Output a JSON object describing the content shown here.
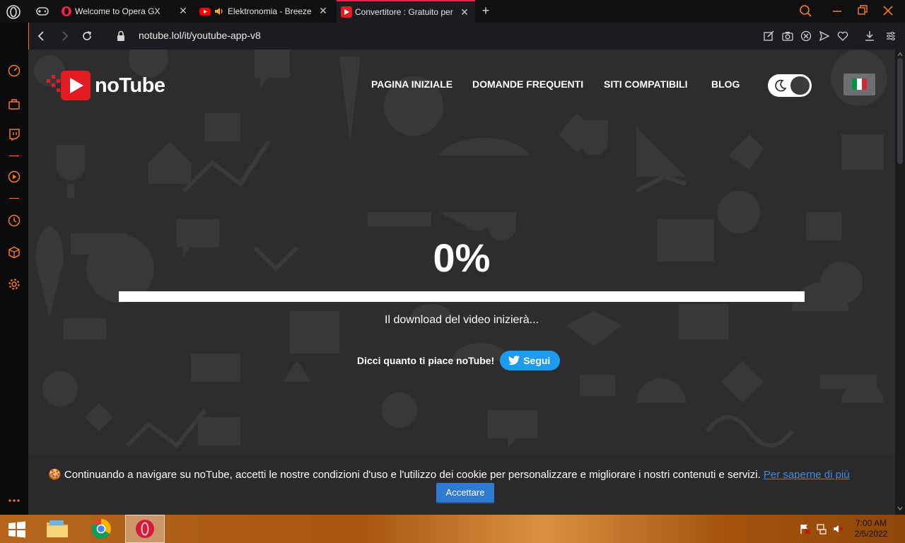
{
  "tabs": [
    {
      "title": "Welcome to Opera GX",
      "favicon": "opera-icon"
    },
    {
      "title": "Elektronomia - Breeze",
      "favicon": "youtube-icon",
      "audio": true
    },
    {
      "title": "Convertitore : Gratuito per",
      "favicon": "notube-icon",
      "active": true
    }
  ],
  "address": {
    "url": "notube.lol/it/youtube-app-v8"
  },
  "site": {
    "logo": "noTube",
    "nav": [
      "PAGINA INIZIALE",
      "DOMANDE FREQUENTI",
      "SITI COMPATIBILI",
      "BLOG"
    ],
    "language_flag": "italy",
    "dark_mode": true
  },
  "download": {
    "percent_label": "0%",
    "progress": 0,
    "status": "Il download del video inizierà...",
    "share_prompt": "Dicci quanto ti piace noTube!",
    "follow_label": "Segui"
  },
  "cookie": {
    "icon": "cookie-icon",
    "text": "Continuando a navigare su noTube, accetti le nostre condizioni d'uso e l'utilizzo dei cookie per personalizzare e migliorare i nostri contenuti e servizi.",
    "link": "Per saperne di più",
    "accept": "Accettare"
  },
  "taskbar": {
    "time": "7:00 AM",
    "date": "2/5/2022",
    "apps": [
      "file-explorer-icon",
      "chrome-icon",
      "opera-icon"
    ]
  },
  "colors": {
    "accent_opera": "#fa1e4e",
    "accent_gx": "#fa7a1e",
    "notube_red": "#e31b23",
    "twitter_blue": "#1d9bf0",
    "page_bg": "#2d2d2f"
  }
}
